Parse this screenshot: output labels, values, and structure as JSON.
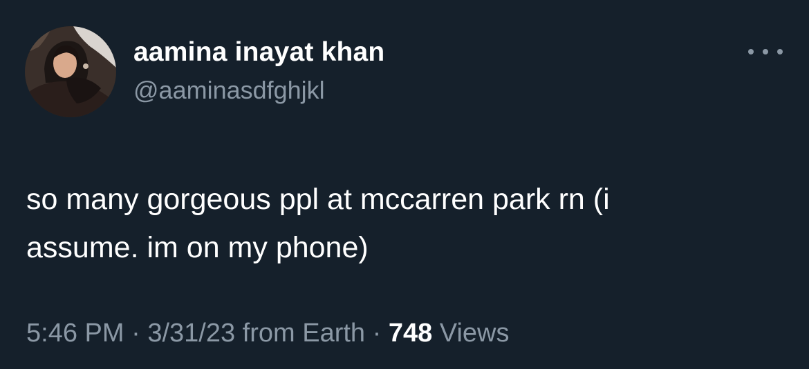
{
  "tweet": {
    "author": {
      "display_name": "aamina inayat khan",
      "handle": "@aaminasdfghjkl"
    },
    "text_lines": [
      "so many gorgeous ppl at mccarren park rn (i",
      "assume. im on my phone)"
    ],
    "meta": {
      "time": "5:46 PM",
      "separator": " · ",
      "date": "3/31/23",
      "source": " from Earth",
      "views_count": "748",
      "views_label": " Views"
    }
  },
  "colors": {
    "background": "#15202b",
    "primary_text": "#ffffff",
    "secondary_text": "#8b98a5"
  },
  "icons": {
    "more": "more-horizontal-icon"
  }
}
